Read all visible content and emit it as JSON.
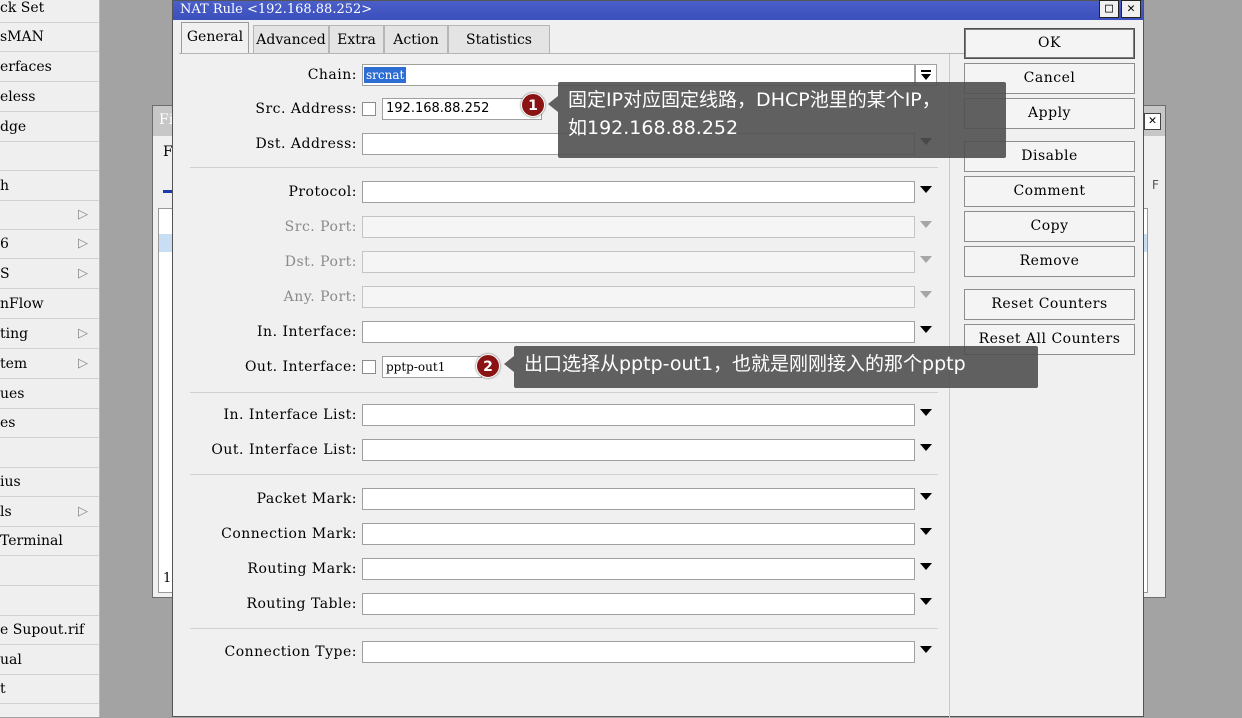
{
  "menu": {
    "items": [
      {
        "label": "ck Set",
        "arrow": false
      },
      {
        "label": "sMAN",
        "arrow": false
      },
      {
        "label": "erfaces",
        "arrow": false
      },
      {
        "label": "eless",
        "arrow": false
      },
      {
        "label": "dge",
        "arrow": false
      },
      {
        "label": "",
        "arrow": false
      },
      {
        "label": "h",
        "arrow": false
      },
      {
        "label": "",
        "arrow": true
      },
      {
        "label": "6",
        "arrow": true
      },
      {
        "label": "S",
        "arrow": true
      },
      {
        "label": "nFlow",
        "arrow": false
      },
      {
        "label": "ting",
        "arrow": true
      },
      {
        "label": "tem",
        "arrow": true
      },
      {
        "label": "ues",
        "arrow": false
      },
      {
        "label": "es",
        "arrow": false
      },
      {
        "label": "",
        "arrow": false
      },
      {
        "label": "ius",
        "arrow": false
      },
      {
        "label": "ls",
        "arrow": true
      },
      {
        "label": " Terminal",
        "arrow": false
      },
      {
        "label": "",
        "arrow": false
      },
      {
        "label": "",
        "arrow": false
      },
      {
        "label": "e Supout.rif",
        "arrow": false
      },
      {
        "label": "ual",
        "arrow": false
      },
      {
        "label": "t",
        "arrow": false
      }
    ],
    "arrow_glyph": "▷"
  },
  "bg_window": {
    "title_fragment": "Fi",
    "tab_fragment": "F",
    "filter_fragment": "F",
    "count_fragment": "1",
    "close_glyph": "✕"
  },
  "dialog": {
    "title": "NAT Rule <192.168.88.252>",
    "max_glyph": "□",
    "close_glyph": "✕",
    "tabs": [
      "General",
      "Advanced",
      "Extra",
      "Action",
      "Statistics"
    ],
    "active_tab": "General"
  },
  "form": {
    "chain": {
      "label": "Chain:",
      "value": "srcnat"
    },
    "src_address": {
      "label": "Src. Address:",
      "value": "192.168.88.252"
    },
    "dst_address": {
      "label": "Dst. Address:"
    },
    "protocol": {
      "label": "Protocol:"
    },
    "src_port": {
      "label": "Src. Port:"
    },
    "dst_port": {
      "label": "Dst. Port:"
    },
    "any_port": {
      "label": "Any. Port:"
    },
    "in_interface": {
      "label": "In. Interface:"
    },
    "out_interface": {
      "label": "Out. Interface:",
      "value": "pptp-out1"
    },
    "in_interface_list": {
      "label": "In. Interface List:"
    },
    "out_interface_list": {
      "label": "Out. Interface List:"
    },
    "packet_mark": {
      "label": "Packet Mark:"
    },
    "connection_mark": {
      "label": "Connection Mark:"
    },
    "routing_mark": {
      "label": "Routing Mark:"
    },
    "routing_table": {
      "label": "Routing Table:"
    },
    "connection_type": {
      "label": "Connection Type:"
    }
  },
  "buttons": {
    "ok": "OK",
    "cancel": "Cancel",
    "apply": "Apply",
    "disable": "Disable",
    "comment": "Comment",
    "copy": "Copy",
    "remove": "Remove",
    "reset_counters": "Reset Counters",
    "reset_all_counters": "Reset All Counters"
  },
  "annotations": [
    {
      "number": "1",
      "line1": "固定IP对应固定线路，DHCP池里的某个IP，",
      "line2": "如192.168.88.252"
    },
    {
      "number": "2",
      "line1": "出口选择从pptp-out1，也就是刚刚接入的那个pptp"
    }
  ],
  "colors": {
    "titlebar": "#3b4fbd",
    "selection": "#2e6dd2",
    "badge": "#8a1414",
    "callout_bg": "#505050"
  }
}
